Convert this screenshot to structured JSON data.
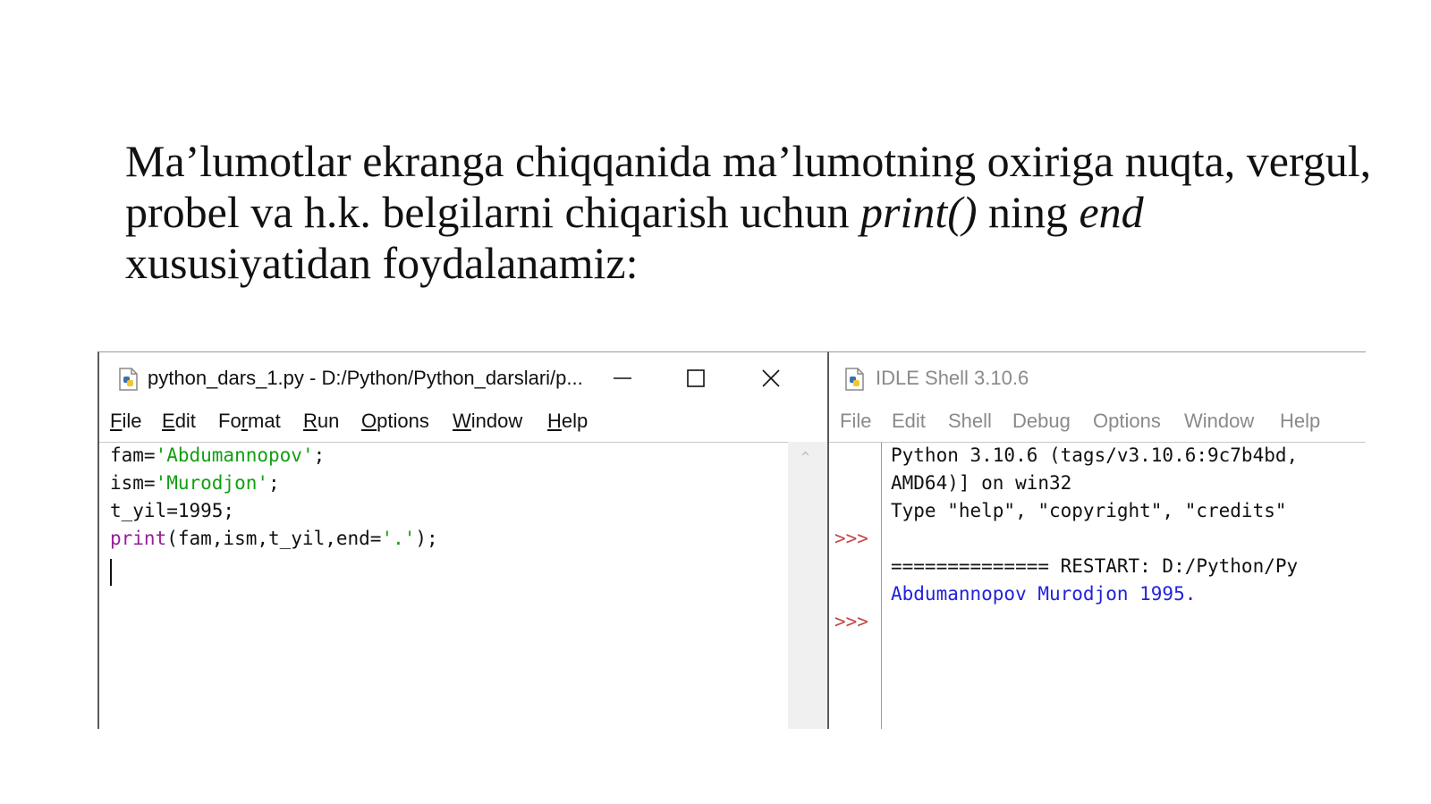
{
  "slide": {
    "heading_part1": "Ma’lumotlar ekranga chiqqanida ma’lumotning oxiriga nuqta, vergul, probel va h.k. belgilarni chiqarish uchun ",
    "heading_italic1": "print()",
    "heading_part2": " ning ",
    "heading_italic2": "end",
    "heading_part3": " xususiyatidan foydalanamiz:"
  },
  "editor_window": {
    "title": "python_dars_1.py - D:/Python/Python_darslari/p...",
    "icon": "python-file-icon",
    "menu": [
      {
        "first": "F",
        "rest": "ile"
      },
      {
        "first": "E",
        "rest": "dit"
      },
      {
        "first": "F",
        "rest": "o",
        "u": "r",
        "tail": "mat"
      },
      {
        "first": "R",
        "rest": "un"
      },
      {
        "first": "O",
        "rest": "ptions"
      },
      {
        "first": "W",
        "rest": "indow"
      },
      {
        "first": "H",
        "rest": "elp"
      }
    ],
    "menu_labels": [
      "File",
      "Edit",
      "Format",
      "Run",
      "Options",
      "Window",
      "Help"
    ],
    "code": {
      "l1_a": "fam=",
      "l1_s": "'Abdumannopov'",
      "l1_b": ";",
      "l2_a": "ism=",
      "l2_s": "'Murodjon'",
      "l2_b": ";",
      "l3": "t_yil=1995;",
      "l4_kw": "print",
      "l4_a": "(fam,ism,t_yil,end=",
      "l4_s": "'.'",
      "l4_b": ");"
    }
  },
  "shell_window": {
    "title": "IDLE Shell 3.10.6",
    "icon": "python-shell-icon",
    "menu_labels": [
      "File",
      "Edit",
      "Shell",
      "Debug",
      "Options",
      "Window",
      "Help"
    ],
    "prompts": [
      ">>>",
      ">>>"
    ],
    "output": [
      "Python 3.10.6 (tags/v3.10.6:9c7b4bd,",
      "AMD64)] on win32",
      "Type \"help\", \"copyright\", \"credits\"",
      "",
      "============== RESTART: D:/Python/Py"
    ],
    "program_output": "Abdumannopov Murodjon 1995."
  },
  "colors": {
    "keyword": "#9a1d9a",
    "string": "#11a011",
    "stdout": "#2222dd",
    "prompt": "#c14a4a"
  }
}
